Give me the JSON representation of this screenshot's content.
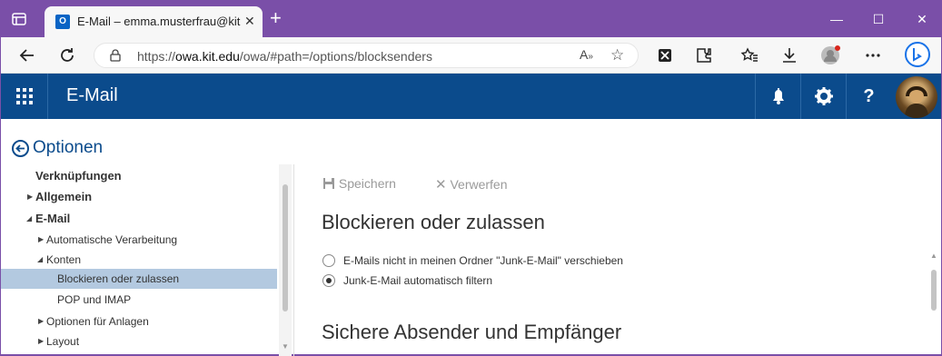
{
  "browser": {
    "tab_title": "E-Mail – emma.musterfrau@kit.e",
    "tab_close": "✕",
    "new_tab": "+",
    "url_prefix": "https://",
    "url_host": "owa.kit.edu",
    "url_path": "/owa/#path=/options/blocksenders",
    "window_controls": {
      "minimize": "—",
      "maximize": "☐",
      "close": "✕"
    },
    "icons": [
      "back-icon",
      "refresh-icon",
      "lock-icon",
      "read-aloud-icon",
      "add-favorite-icon",
      "extension-x-icon",
      "extensions-icon",
      "favorites-icon",
      "downloads-icon",
      "profile-icon",
      "more-icon",
      "bing-icon"
    ]
  },
  "owa": {
    "app_title": "E-Mail",
    "header_icons": [
      "bell-icon",
      "gear-icon",
      "help-icon",
      "avatar"
    ],
    "help_label": "?"
  },
  "options": {
    "title": "Optionen",
    "nav": [
      {
        "label": "Verknüpfungen",
        "level": 0,
        "caret": "",
        "bold": true
      },
      {
        "label": "Allgemein",
        "level": 0,
        "caret": "right",
        "bold": true
      },
      {
        "label": "E-Mail",
        "level": 0,
        "caret": "down",
        "bold": true
      },
      {
        "label": "Automatische Verarbeitung",
        "level": 1,
        "caret": "right"
      },
      {
        "label": "Konten",
        "level": 1,
        "caret": "down"
      },
      {
        "label": "Blockieren oder zulassen",
        "level": 2,
        "caret": "",
        "selected": true
      },
      {
        "label": "POP und IMAP",
        "level": 2,
        "caret": ""
      },
      {
        "label": "Optionen für Anlagen",
        "level": 1,
        "caret": "right"
      },
      {
        "label": "Layout",
        "level": 1,
        "caret": "right"
      }
    ]
  },
  "content": {
    "save_label": "Speichern",
    "discard_label": "Verwerfen",
    "heading": "Blockieren oder zulassen",
    "radio_1": "E-Mails nicht in meinen Ordner \"Junk-E-Mail\" verschieben",
    "radio_2": "Junk-E-Mail automatisch filtern",
    "selected_radio": 2,
    "section2_heading": "Sichere Absender und Empfänger"
  },
  "colors": {
    "browser_frame": "#7a4fa8",
    "owa_header": "#0b4b8c",
    "nav_selected": "#b3c9e0"
  }
}
